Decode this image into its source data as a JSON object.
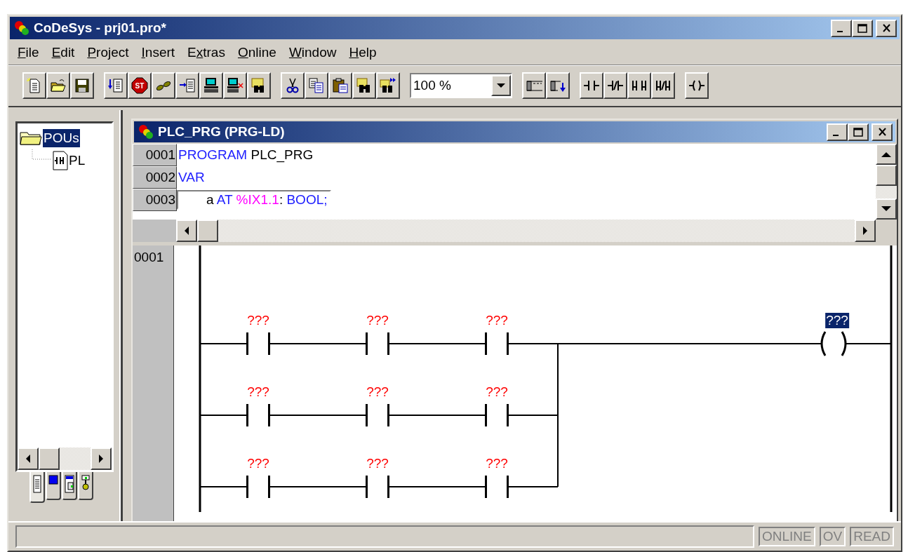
{
  "window": {
    "title": "CoDeSys - prj01.pro*"
  },
  "menu": [
    {
      "key": "F",
      "after": "ile"
    },
    {
      "key": "E",
      "after": "dit"
    },
    {
      "key": "P",
      "after": "roject"
    },
    {
      "key": "I",
      "after": "nsert"
    },
    {
      "before": "E",
      "key": "x",
      "after": "tras"
    },
    {
      "key": "O",
      "after": "nline"
    },
    {
      "key": "W",
      "after": "indow"
    },
    {
      "key": "H",
      "after": "elp"
    }
  ],
  "toolbar": {
    "stop_icon_text": "ST",
    "zoom": {
      "value": "100 %"
    }
  },
  "object_tree": [
    {
      "label": "POUs",
      "selected": true,
      "expanded": true,
      "children": [
        {
          "label": "PL",
          "selected": false
        }
      ]
    }
  ],
  "object_tabs": [
    {
      "kind": "pous",
      "selected": true
    },
    {
      "kind": "data_types",
      "selected": false
    },
    {
      "kind": "visualizations",
      "selected": false
    },
    {
      "kind": "resources",
      "selected": false
    }
  ],
  "editor": {
    "title": "PLC_PRG (PRG-LD)",
    "declaration": {
      "lines": [
        {
          "number": "0001",
          "indented": false,
          "tokens": [
            {
              "text": "PROGRAM",
              "kind": "keyword"
            },
            {
              "text": " PLC_PRG",
              "kind": "plain"
            }
          ]
        },
        {
          "number": "0002",
          "indented": false,
          "tokens": [
            {
              "text": "VAR",
              "kind": "keyword"
            }
          ]
        },
        {
          "number": "0003",
          "indented": true,
          "tokens": [
            {
              "text": "a",
              "kind": "plain"
            },
            {
              "text": " AT",
              "kind": "keyword"
            },
            {
              "text": " %IX1.1",
              "kind": "address"
            },
            {
              "text": ":",
              "kind": "plain"
            },
            {
              "text": " BOOL;",
              "kind": "keyword"
            }
          ]
        }
      ]
    },
    "ladder": {
      "networks": [
        {
          "number": "0001",
          "branches": [
            {
              "contacts": [
                {
                  "label": "???"
                },
                {
                  "label": "???"
                },
                {
                  "label": "???"
                }
              ]
            },
            {
              "contacts": [
                {
                  "label": "???"
                },
                {
                  "label": "???"
                },
                {
                  "label": "???"
                }
              ]
            },
            {
              "contacts": [
                {
                  "label": "???"
                },
                {
                  "label": "???"
                },
                {
                  "label": "???"
                }
              ]
            }
          ],
          "coil": {
            "label": "???",
            "selected": true
          }
        }
      ]
    }
  },
  "status_bar": {
    "indicators": [
      {
        "label": "ONLINE",
        "active": false
      },
      {
        "label": "OV",
        "active": false
      },
      {
        "label": "READ",
        "active": false
      }
    ]
  }
}
